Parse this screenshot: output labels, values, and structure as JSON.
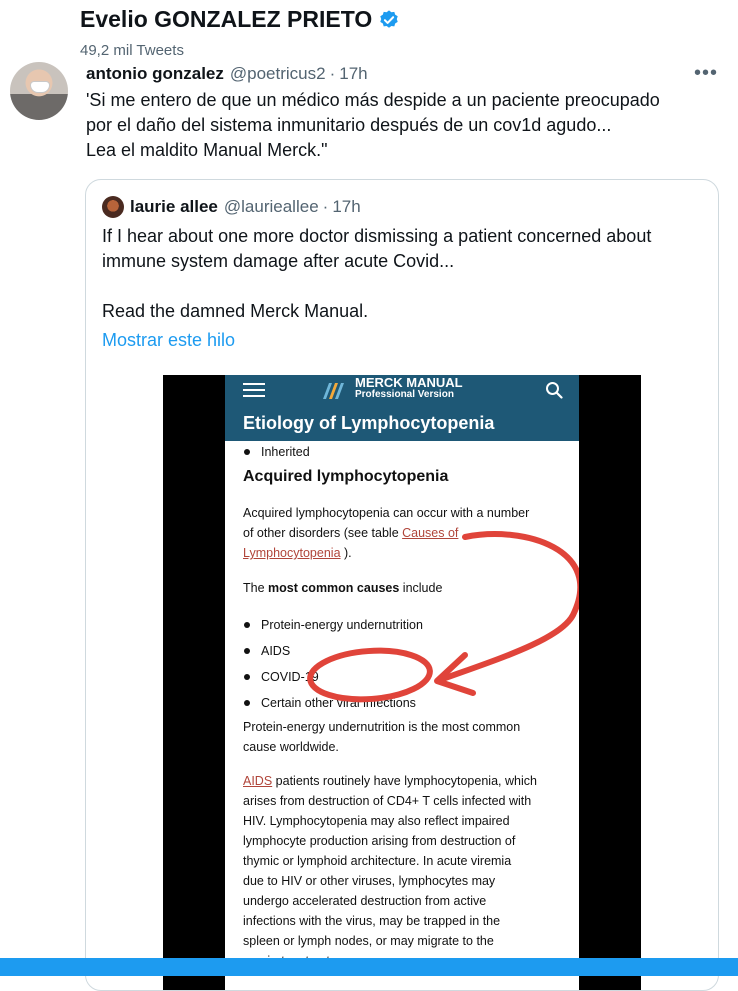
{
  "profile_header": {
    "name": "Evelio GONZALEZ PRIETO",
    "tweet_count": "49,2 mil Tweets"
  },
  "tweet": {
    "author_name": "antonio gonzalez",
    "handle": "@poetricus2",
    "separator": "·",
    "time": "17h",
    "more_label": "•••",
    "text_lines": [
      "'Si me entero de que un médico más despide a un paciente preocupado",
      "por el daño del sistema inmunitario después de un cov1d agudo...",
      "Lea el maldito Manual Merck.\""
    ]
  },
  "quoted_tweet": {
    "author_name": "laurie allee",
    "handle": "@laurieallee",
    "separator": "·",
    "time": "17h",
    "text_lines": [
      "If I hear about one more doctor dismissing a patient concerned about",
      "immune system damage after acute Covid...",
      "",
      "Read the damned Merck Manual."
    ],
    "show_thread": "Mostrar este hilo"
  },
  "merck_page": {
    "brand": "MERCK MANUAL",
    "brand_sub": "Professional Version",
    "section_title": "Etiology of Lymphocytopenia",
    "inherited": "Inherited",
    "heading": "Acquired lymphocytopenia",
    "para1_a": "Acquired lymphocytopenia can occur with a number",
    "para1_b": "of other disorders (see table ",
    "para1_link1": "Causes of",
    "para1_link2": "Lymphocytopenia",
    "para1_c": " ).",
    "causes_intro_pre": "The ",
    "causes_intro_bold": "most common causes",
    "causes_intro_post": " include",
    "bullets": [
      "Protein-energy undernutrition",
      "AIDS",
      "COVID-19",
      "Certain other viral infections"
    ],
    "para2_lines": [
      "Protein-energy undernutrition is the most common",
      "cause worldwide."
    ],
    "aids_link": "AIDS",
    "para3_first": " patients routinely have lymphocytopenia, which",
    "para3_lines": [
      "arises from destruction of CD4+ T cells infected with",
      "HIV. Lymphocytopenia may also reflect impaired",
      "lymphocyte production arising from destruction of",
      "thymic or lymphoid architecture. In acute viremia",
      "due to HIV or other viruses, lymphocytes may",
      "undergo accelerated destruction from active",
      "infections with the virus, may be trapped in the",
      "spleen or lymph nodes, or may migrate to the",
      "respiratory tract."
    ]
  },
  "colors": {
    "accent": "#1d9bf0",
    "merck_blue": "#1e5876",
    "annotation_red": "#e0443a",
    "secondary_text": "#536471"
  }
}
